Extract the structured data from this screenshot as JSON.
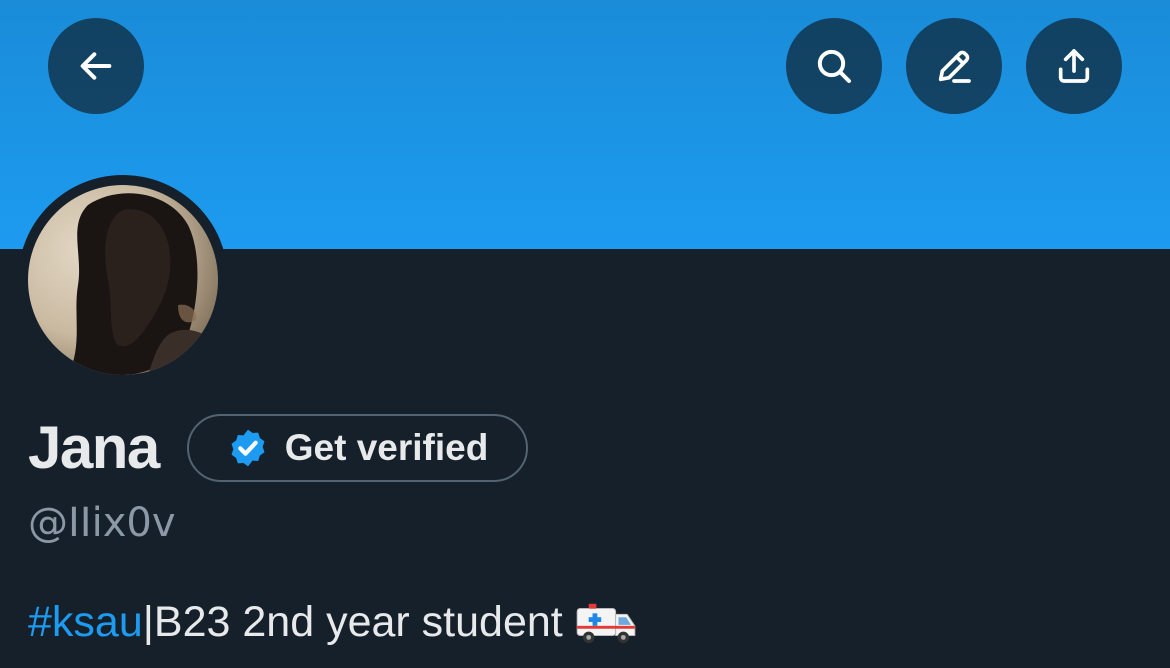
{
  "header": {
    "back_button": {
      "icon": "back-arrow-icon"
    },
    "search_button": {
      "icon": "search-icon"
    },
    "edit_button": {
      "icon": "edit-pencil-icon"
    },
    "share_button": {
      "icon": "share-upload-icon"
    },
    "banner_color": "#1d9bf0",
    "button_color": "#0f1419"
  },
  "profile": {
    "avatar": "profile-photo",
    "name": "Jana",
    "get_verified_label": "Get verified",
    "verified_badge_color": "#1d9bf0",
    "handle": "@IIix0v",
    "bio": {
      "hashtag": "#ksau",
      "text": "|B23 2nd year student",
      "emoji": "ambulance-emoji"
    }
  },
  "theme": {
    "background": "#15202b",
    "text": "#e7e9ea",
    "muted_text": "#8b98a5",
    "link": "#1d9bf0"
  }
}
